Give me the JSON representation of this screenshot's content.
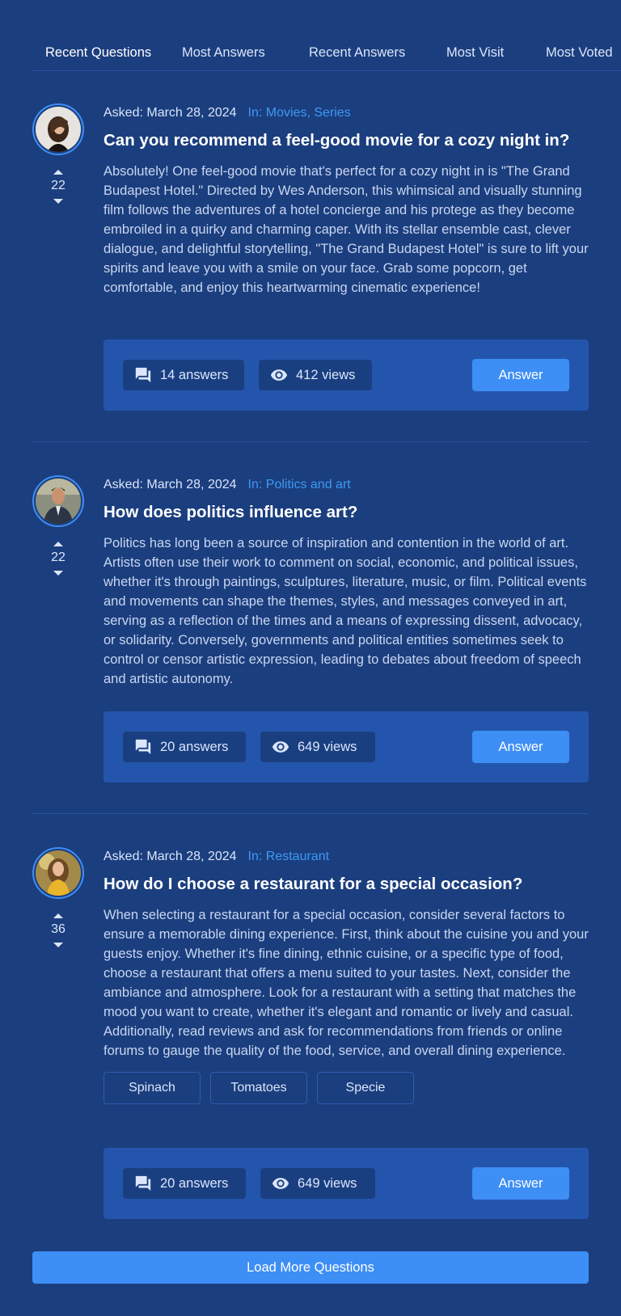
{
  "tabs": [
    {
      "label": "Recent Questions",
      "active": true
    },
    {
      "label": "Most Answers",
      "active": false
    },
    {
      "label": "Recent Answers",
      "active": false
    },
    {
      "label": "Most Visit",
      "active": false
    },
    {
      "label": "Most Voted",
      "active": false
    }
  ],
  "questions": [
    {
      "asked": "Asked: March 28, 2024",
      "category": "In: Movies, Series",
      "title": "Can you recommend a feel-good movie for a cozy night in?",
      "body": "Absolutely! One feel-good movie that's perfect for a cozy night in is \"The Grand Budapest Hotel.\" Directed by Wes Anderson, this whimsical and visually stunning film follows the adventures of a hotel concierge and his protege as they become embroiled in a quirky and charming caper. With its stellar ensemble cast, clever dialogue, and delightful storytelling, \"The Grand Budapest Hotel\" is sure to lift your spirits and leave you with a smile on your face. Grab some popcorn, get comfortable, and enjoy this heartwarming cinematic experience!",
      "votes": "22",
      "answers": "14 answers",
      "views": "412 views",
      "answer_label": "Answer",
      "tags": [],
      "avatar_icon": "user-avatar-woman-dark-hair"
    },
    {
      "asked": "Asked: March 28, 2024",
      "category": "In: Politics and art",
      "title": "How does politics influence art?",
      "body": "Politics has long been a source of inspiration and contention in the world of art. Artists often use their work to comment on social, economic, and political issues, whether it's through paintings, sculptures, literature, music, or film. Political events and movements can shape the themes, styles, and messages conveyed in art, serving as a reflection of the times and a means of expressing dissent, advocacy, or solidarity. Conversely, governments and political entities sometimes seek to control or censor artistic expression, leading to debates about freedom of speech and artistic autonomy.",
      "votes": "22",
      "answers": "20 answers",
      "views": "649 views",
      "answer_label": "Answer",
      "tags": [],
      "avatar_icon": "user-avatar-man-suit"
    },
    {
      "asked": "Asked: March 28, 2024",
      "category": "In: Restaurant",
      "title": "How do I choose a restaurant for a special occasion?",
      "body": "When selecting a restaurant for a special occasion, consider several factors to ensure a memorable dining experience. First, think about the cuisine you and your guests enjoy. Whether it's fine dining, ethnic cuisine, or a specific type of food, choose a restaurant that offers a menu suited to your tastes. Next, consider the ambiance and atmosphere. Look for a restaurant with a setting that matches the mood you want to create, whether it's elegant and romantic or lively and casual. Additionally, read reviews and ask for recommendations from friends or online forums to gauge the quality of the food, service, and overall dining experience.",
      "votes": "36",
      "answers": "20 answers",
      "views": "649 views",
      "answer_label": "Answer",
      "tags": [
        "Spinach",
        "Tomatoes",
        "Specie"
      ],
      "avatar_icon": "user-avatar-woman-yellow"
    }
  ],
  "load_more_label": "Load More Questions",
  "colors": {
    "background": "#1b3e7e",
    "accent": "#3d8ef5",
    "category_link": "#3d9af5",
    "action_bar": "#2455ad",
    "pill": "#1a3f80"
  }
}
